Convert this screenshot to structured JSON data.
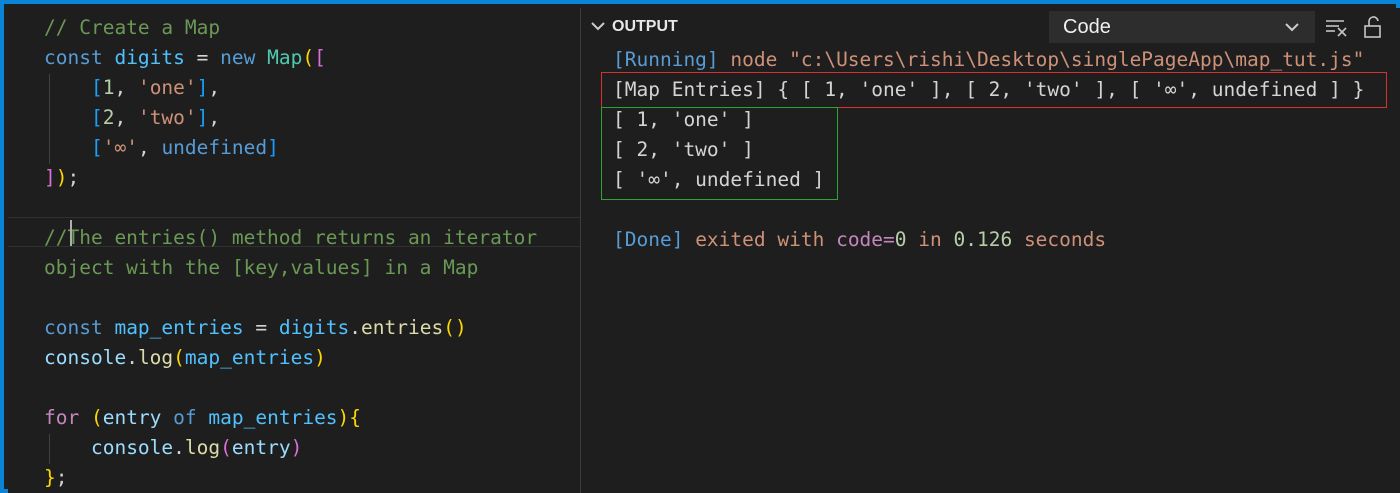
{
  "colors": {
    "frame": "#0a84d6",
    "background": "#1e1e1e",
    "highlight_red": "#d83030",
    "highlight_green": "#2fa32f"
  },
  "editor": {
    "lines": [
      {
        "tokens": [
          {
            "t": "// Create a Map",
            "c": "cmt"
          }
        ]
      },
      {
        "tokens": [
          {
            "t": "const ",
            "c": "kw"
          },
          {
            "t": "digits",
            "c": "var"
          },
          {
            "t": " = ",
            "c": "pl"
          },
          {
            "t": "new ",
            "c": "kw"
          },
          {
            "t": "Map",
            "c": "cls"
          },
          {
            "t": "(",
            "c": "b3"
          },
          {
            "t": "[",
            "c": "b1"
          }
        ]
      },
      {
        "tokens": [
          {
            "t": "    ",
            "c": "pl"
          },
          {
            "t": "[",
            "c": "b2"
          },
          {
            "t": "1",
            "c": "num"
          },
          {
            "t": ", ",
            "c": "pl"
          },
          {
            "t": "'one'",
            "c": "str"
          },
          {
            "t": "]",
            "c": "b2"
          },
          {
            "t": ",",
            "c": "pl"
          }
        ]
      },
      {
        "tokens": [
          {
            "t": "    ",
            "c": "pl"
          },
          {
            "t": "[",
            "c": "b2"
          },
          {
            "t": "2",
            "c": "num"
          },
          {
            "t": ", ",
            "c": "pl"
          },
          {
            "t": "'two'",
            "c": "str"
          },
          {
            "t": "]",
            "c": "b2"
          },
          {
            "t": ",",
            "c": "pl"
          }
        ]
      },
      {
        "tokens": [
          {
            "t": "    ",
            "c": "pl"
          },
          {
            "t": "[",
            "c": "b2"
          },
          {
            "t": "'∞'",
            "c": "str"
          },
          {
            "t": ", ",
            "c": "pl"
          },
          {
            "t": "undefined",
            "c": "kw"
          },
          {
            "t": "]",
            "c": "b2"
          }
        ]
      },
      {
        "tokens": [
          {
            "t": "]",
            "c": "b1"
          },
          {
            "t": ")",
            "c": "b3"
          },
          {
            "t": ";",
            "c": "pl"
          }
        ]
      },
      {
        "tokens": []
      },
      {
        "tokens": [
          {
            "t": "//The entries() method returns an iterator",
            "c": "cmt"
          }
        ]
      },
      {
        "tokens": [
          {
            "t": "object with the [key,values] in a Map",
            "c": "cmt"
          }
        ]
      },
      {
        "tokens": []
      },
      {
        "tokens": [
          {
            "t": "const ",
            "c": "kw"
          },
          {
            "t": "map_entries",
            "c": "var"
          },
          {
            "t": " = ",
            "c": "pl"
          },
          {
            "t": "digits",
            "c": "var"
          },
          {
            "t": ".",
            "c": "pl"
          },
          {
            "t": "entries",
            "c": "fn"
          },
          {
            "t": "()",
            "c": "b3"
          }
        ]
      },
      {
        "tokens": [
          {
            "t": "console",
            "c": "id"
          },
          {
            "t": ".",
            "c": "pl"
          },
          {
            "t": "log",
            "c": "fn"
          },
          {
            "t": "(",
            "c": "b3"
          },
          {
            "t": "map_entries",
            "c": "var"
          },
          {
            "t": ")",
            "c": "b3"
          }
        ]
      },
      {
        "tokens": []
      },
      {
        "tokens": [
          {
            "t": "for ",
            "c": "kw2"
          },
          {
            "t": "(",
            "c": "b3"
          },
          {
            "t": "entry ",
            "c": "id"
          },
          {
            "t": "of ",
            "c": "kw"
          },
          {
            "t": "map_entries",
            "c": "var"
          },
          {
            "t": ")",
            "c": "b3"
          },
          {
            "t": "{",
            "c": "b3"
          }
        ]
      },
      {
        "tokens": [
          {
            "t": "    ",
            "c": "pl"
          },
          {
            "t": "console",
            "c": "id"
          },
          {
            "t": ".",
            "c": "pl"
          },
          {
            "t": "log",
            "c": "fn"
          },
          {
            "t": "(",
            "c": "b1"
          },
          {
            "t": "entry",
            "c": "id"
          },
          {
            "t": ")",
            "c": "b1"
          }
        ]
      },
      {
        "tokens": [
          {
            "t": "}",
            "c": "b3"
          },
          {
            "t": ";",
            "c": "pl"
          }
        ]
      }
    ]
  },
  "output_panel": {
    "title": "OUTPUT",
    "channel_select": "Code",
    "icons": [
      "chevron-down-icon",
      "clear-output-icon",
      "lock-icon"
    ],
    "lines": [
      {
        "tokens": [
          {
            "t": "[Running]",
            "c": "o-run"
          },
          {
            "t": " node \"c:\\Users\\rishi\\Desktop\\singlePageApp\\map_tut.js\"",
            "c": "o-path"
          }
        ]
      },
      {
        "tokens": [
          {
            "t": "[Map Entries] { [ 1, 'one' ], [ 2, 'two' ], [ '∞', undefined ] }",
            "c": "pl"
          }
        ]
      },
      {
        "tokens": [
          {
            "t": "[ 1, 'one' ]",
            "c": "pl"
          }
        ]
      },
      {
        "tokens": [
          {
            "t": "[ 2, 'two' ]",
            "c": "pl"
          }
        ]
      },
      {
        "tokens": [
          {
            "t": "[ '∞', undefined ]",
            "c": "pl"
          }
        ]
      },
      {
        "tokens": []
      },
      {
        "tokens": [
          {
            "t": "[Done]",
            "c": "o-done"
          },
          {
            "t": " exited with ",
            "c": "o-msg"
          },
          {
            "t": "code=",
            "c": "o-code"
          },
          {
            "t": "0",
            "c": "o-num"
          },
          {
            "t": " in ",
            "c": "o-msg"
          },
          {
            "t": "0.126",
            "c": "o-num"
          },
          {
            "t": " seconds",
            "c": "o-msg"
          }
        ]
      }
    ]
  }
}
